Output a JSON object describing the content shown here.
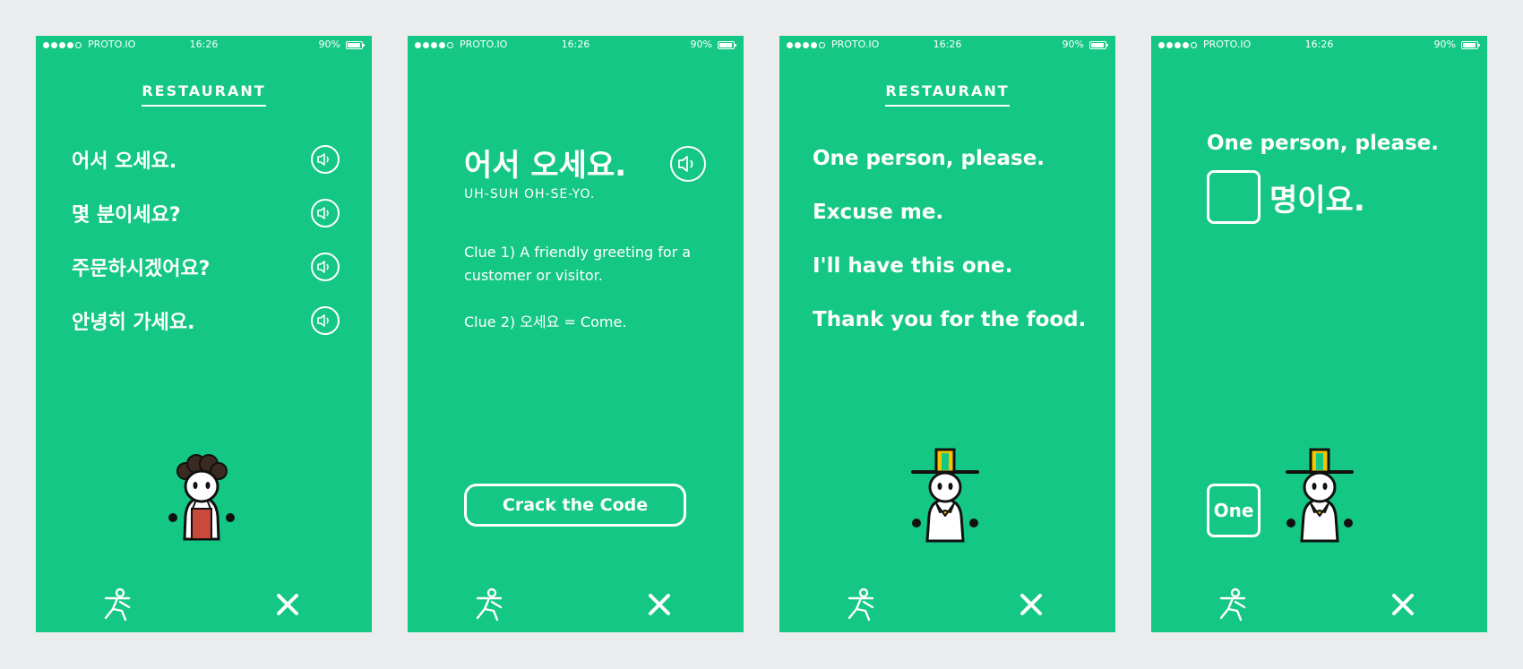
{
  "status_bar": {
    "carrier": "PROTO.IO",
    "time": "16:26",
    "battery": "90%"
  },
  "screen1": {
    "title": "RESTAURANT",
    "phrases": [
      "어서 오세요.",
      "몇 분이세요?",
      "주문하시겠어요?",
      "안녕히 가세요."
    ]
  },
  "screen2": {
    "phrase": "어서 오세요.",
    "romanization": "UH-SUH OH-SE-YO.",
    "clue1": "Clue 1) A friendly greeting for a customer or visitor.",
    "clue2": "Clue 2) 오세요 = Come.",
    "button_label": "Crack the Code"
  },
  "screen3": {
    "title": "RESTAURANT",
    "phrases": [
      "One person, please.",
      "Excuse me.",
      "I'll have this one.",
      "Thank you for the food."
    ]
  },
  "screen4": {
    "question": "One person, please.",
    "answer_suffix": "명이요.",
    "word_tile": "One"
  },
  "icons": {
    "speaker": "speaker-icon",
    "runner": "running-person-icon",
    "close": "close-icon"
  },
  "colors": {
    "screen_bg": "#14c785",
    "page_bg": "#ebecee",
    "apron": "#c9493a",
    "hat_gold": "#f5c400"
  }
}
